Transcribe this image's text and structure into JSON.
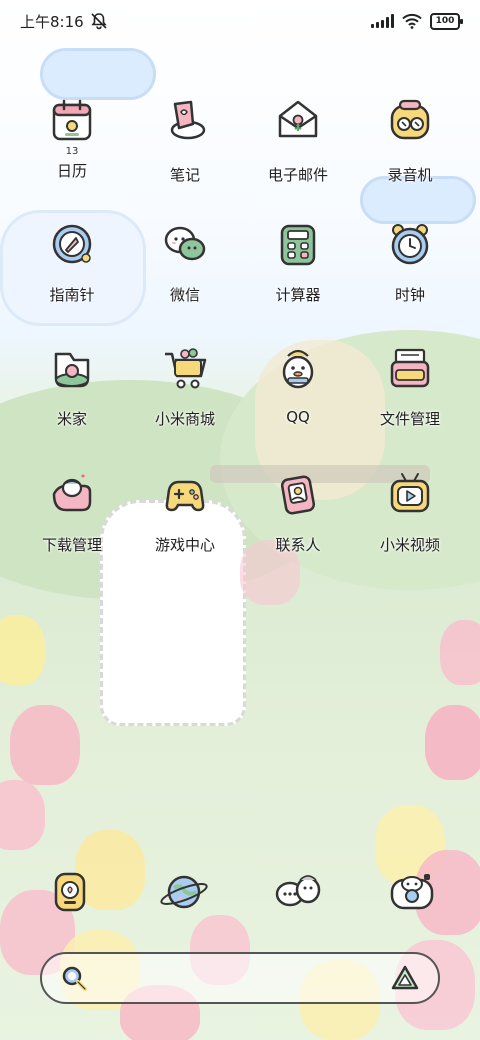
{
  "status_bar": {
    "time": "上午8:16",
    "battery": "100",
    "icons": [
      "mute-bell-icon",
      "signal-icon",
      "wifi-icon",
      "battery-icon"
    ]
  },
  "apps": [
    {
      "label": "日历",
      "sub": "13",
      "icon": "calendar-icon"
    },
    {
      "label": "笔记",
      "icon": "notes-icon"
    },
    {
      "label": "电子邮件",
      "icon": "mail-icon"
    },
    {
      "label": "录音机",
      "icon": "recorder-icon"
    },
    {
      "label": "指南针",
      "icon": "compass-icon"
    },
    {
      "label": "微信",
      "icon": "wechat-icon"
    },
    {
      "label": "计算器",
      "icon": "calculator-icon"
    },
    {
      "label": "时钟",
      "icon": "clock-icon"
    },
    {
      "label": "米家",
      "icon": "mijia-icon"
    },
    {
      "label": "小米商城",
      "icon": "shopping-cart-icon"
    },
    {
      "label": "QQ",
      "icon": "qq-icon"
    },
    {
      "label": "文件管理",
      "icon": "file-manager-icon"
    },
    {
      "label": "下载管理",
      "icon": "download-manager-icon"
    },
    {
      "label": "游戏中心",
      "icon": "gamepad-icon"
    },
    {
      "label": "联系人",
      "icon": "contacts-icon"
    },
    {
      "label": "小米视频",
      "icon": "video-icon"
    }
  ],
  "dock": [
    {
      "icon": "phone-icon"
    },
    {
      "icon": "browser-planet-icon"
    },
    {
      "icon": "messages-icon"
    },
    {
      "icon": "camera-icon"
    }
  ],
  "search": {
    "left_icon": "search-icon",
    "right_icon": "assistant-icon"
  },
  "colors": {
    "accent_green": "#8fc59a",
    "accent_yellow": "#f7d87a",
    "accent_pink": "#f4b6c2",
    "accent_blue": "#a9cdf0",
    "outline": "#333333"
  }
}
